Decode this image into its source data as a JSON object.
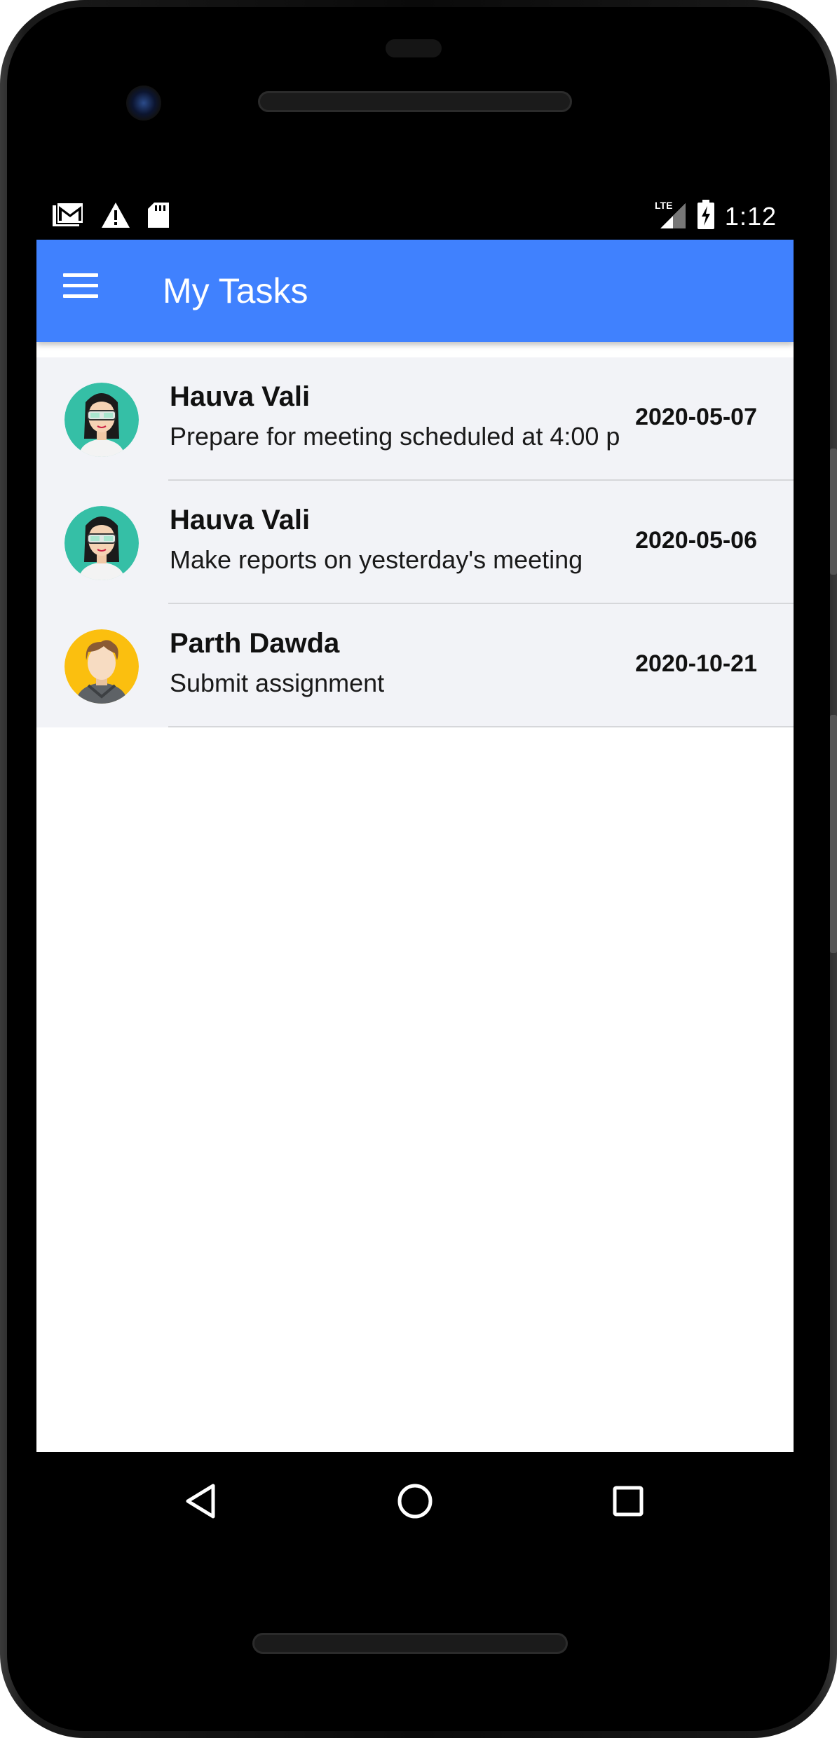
{
  "status_bar": {
    "time": "1:12",
    "network": "LTE",
    "left_icons": [
      "gmail-icon",
      "warning-icon",
      "sd-card-icon"
    ],
    "right_icons": [
      "lte-signal-icon",
      "battery-charging-icon"
    ]
  },
  "app_bar": {
    "title": "My Tasks",
    "color": "#4081fe",
    "menu_icon": "hamburger-menu-icon"
  },
  "tasks": [
    {
      "assignee": "Hauva Vali",
      "description": "Prepare for meeting scheduled at 4:00 p",
      "date": "2020-05-07",
      "avatar": "female-avatar-icon"
    },
    {
      "assignee": "Hauva Vali",
      "description": "Make reports on yesterday's meeting",
      "date": "2020-05-06",
      "avatar": "female-avatar-icon"
    },
    {
      "assignee": "Parth Dawda",
      "description": "Submit assignment",
      "date": "2020-10-21",
      "avatar": "male-avatar-icon"
    }
  ],
  "nav_bar": {
    "buttons": [
      "back-icon",
      "home-icon",
      "recents-icon"
    ]
  }
}
